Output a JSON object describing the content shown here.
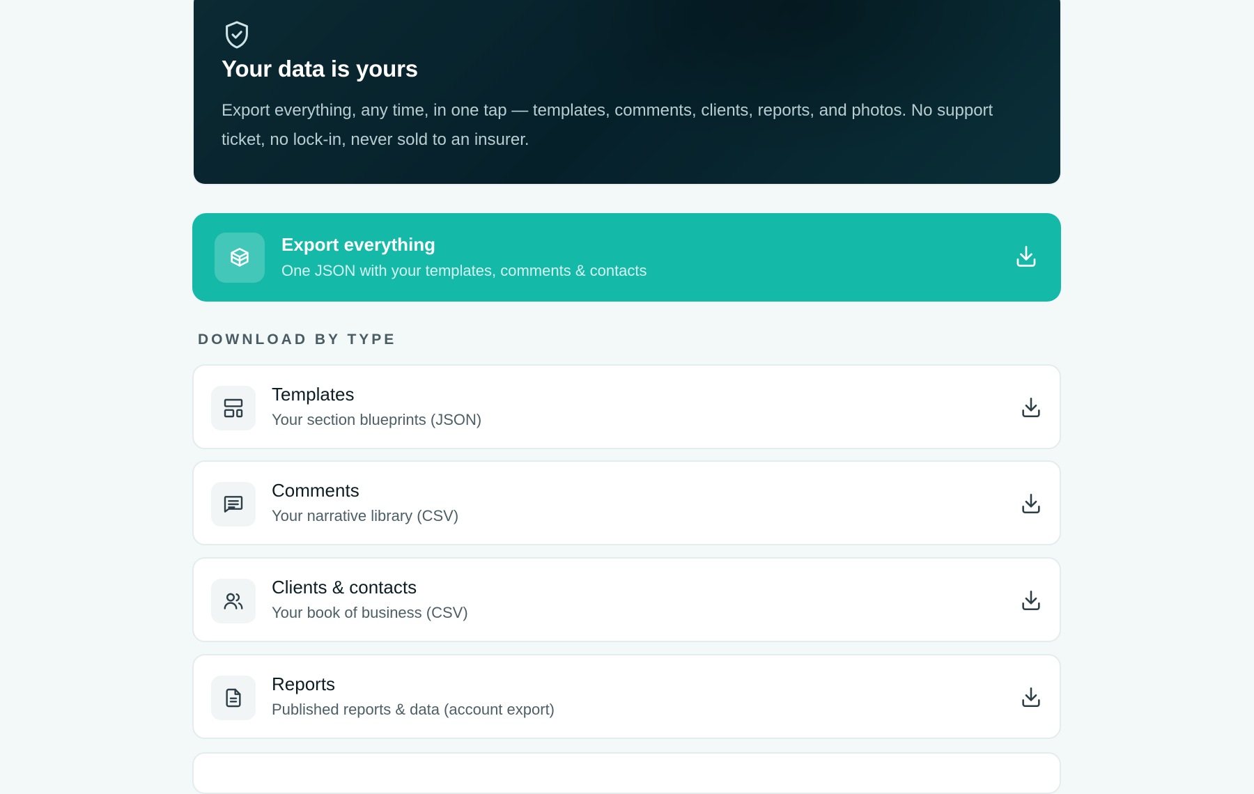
{
  "hero": {
    "icon": "shield-check-icon",
    "title": "Your data is yours",
    "description": "Export everything, any time, in one tap — templates, comments, clients, reports, and photos. No support ticket, no lock-in, never sold to an insurer."
  },
  "export_all": {
    "icon": "package-icon",
    "title": "Export everything",
    "subtitle": "One JSON with your templates, comments & contacts",
    "action_icon": "download-icon",
    "accent_color": "#15b9a8"
  },
  "download_section": {
    "heading": "DOWNLOAD BY TYPE",
    "items": [
      {
        "icon": "layout-template-icon",
        "title": "Templates",
        "subtitle": "Your section blueprints (JSON)"
      },
      {
        "icon": "message-square-text-icon",
        "title": "Comments",
        "subtitle": "Your narrative library (CSV)"
      },
      {
        "icon": "users-icon",
        "title": "Clients & contacts",
        "subtitle": "Your book of business (CSV)"
      },
      {
        "icon": "file-text-icon",
        "title": "Reports",
        "subtitle": "Published reports & data (account export)"
      }
    ]
  },
  "colors": {
    "hero_bg": "#06202a",
    "page_bg": "#f3f8f9",
    "card_border": "#e4ecee"
  }
}
